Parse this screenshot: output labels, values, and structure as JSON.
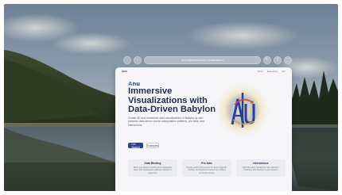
{
  "browser": {
    "url": "anu.ninja/immersive-visualizations",
    "back_glyph": "‹",
    "forward_glyph": "›",
    "reload_glyph": "↻",
    "share_glyph": "⇪",
    "tabs_glyph": "▢"
  },
  "nav": {
    "logo": "Anu",
    "links": [
      "Docs",
      "Examples",
      "API"
    ]
  },
  "hero": {
    "kicker_accent": "A",
    "kicker_rest": "nu",
    "title": "Immersive Visualizations with Data-Driven Babylon",
    "description": "Create 3D and immersive data visualizations in Babylon.js with powerful data-driven scene manipulation patterns, pre-fabs, and interactions.",
    "primary_button": "Get Started",
    "secondary_button": "Examples"
  },
  "logo": {
    "text": "Anu"
  },
  "features": [
    {
      "title": "Data Binding",
      "text": "Bind your data to meshes and manipulate them with declarative methods chained in sequence."
    },
    {
      "title": "Pre-fabs",
      "text": "Ready-made components for axes, legends, tooltips, and layouts to speed up building immersive charts."
    },
    {
      "title": "Interactions",
      "text": "Add XR-ready interactions like selection, brushing, and filtering to your scenes."
    }
  ],
  "colors": {
    "accent": "#3557c6",
    "title": "#1e2a4d",
    "primary_button": "#2e3f8a"
  }
}
